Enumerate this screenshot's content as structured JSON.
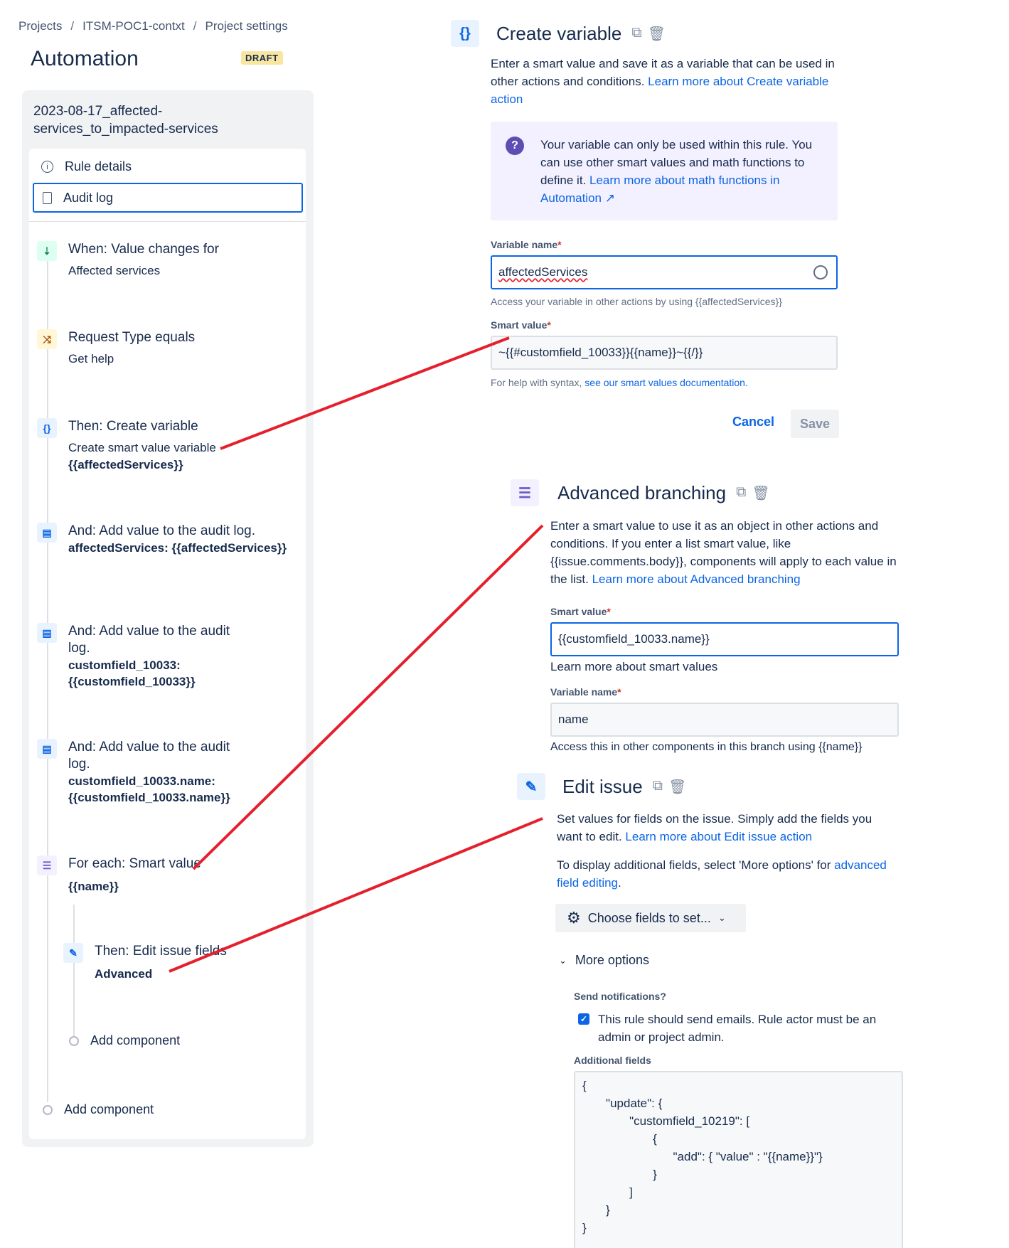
{
  "breadcrumb": {
    "projects": "Projects",
    "project": "ITSM-POC1-contxt",
    "settings": "Project settings",
    "sep": "/"
  },
  "page": {
    "title": "Automation",
    "status": "DRAFT"
  },
  "rule": {
    "name": "2023-08-17_affected-services_to_impacted-services"
  },
  "nav": {
    "rule_details": "Rule details",
    "audit_log": "Audit log"
  },
  "components": {
    "trigger": {
      "title": "When: Value changes for",
      "sub": "Affected services"
    },
    "condition": {
      "title": "Request Type equals",
      "sub": "Get help"
    },
    "create_var": {
      "title": "Then: Create variable",
      "sub": "Create smart value variable",
      "bold": "{{affectedServices}}"
    },
    "log1": {
      "title": "And: Add value to the audit log.",
      "bold": "affectedServices: {{affectedServices}}"
    },
    "log2": {
      "title": "And: Add value to the audit log.",
      "bold": "customfield_10033: {{customfield_10033}}"
    },
    "log3": {
      "title": "And: Add value to the audit log.",
      "bold": "customfield_10033.name: {{customfield_10033.name}}"
    },
    "foreach": {
      "title": "For each: Smart value",
      "bold": "{{name}}"
    },
    "edit": {
      "title": "Then: Edit issue fields",
      "bold": "Advanced"
    },
    "add_inner": "Add component",
    "add_outer": "Add component"
  },
  "create_variable_panel": {
    "title": "Create variable",
    "desc": "Enter a smart value and save it as a variable that can be used in other actions and conditions.",
    "desc_link": "Learn more about Create variable action",
    "info_text": "Your variable can only be used within this rule. You can use other smart values and math functions to define it.",
    "info_link": "Learn more about math functions in Automation ↗",
    "var_label": "Variable name",
    "var_value": "affectedServices",
    "var_help": "Access your variable in other actions by using {{affectedServices}}",
    "smart_label": "Smart value",
    "smart_value": "~{{#customfield_10033}}{{name}}~{{/}}",
    "syntax_help": "For help with syntax,",
    "syntax_link": "see our smart values documentation.",
    "cancel": "Cancel",
    "save": "Save"
  },
  "branch_panel": {
    "title": "Advanced branching",
    "desc": "Enter a smart value to use it as an object in other actions and conditions. If you enter a list smart value, like {{issue.comments.body}}, components will apply to each value in the list.",
    "desc_link": "Learn more about Advanced branching",
    "smart_label": "Smart value",
    "smart_value": "{{customfield_10033.name}}",
    "smart_link": "Learn more about smart values",
    "var_label": "Variable name",
    "var_value": "name",
    "var_help": "Access this in other components in this branch using {{name}}"
  },
  "edit_panel": {
    "title": "Edit issue",
    "desc": "Set values for fields on the issue. Simply add the fields you want to edit.",
    "desc_link": "Learn more about Edit issue action",
    "display": "To display additional fields, select 'More options' for",
    "display_link": "advanced field editing",
    "display_end": ".",
    "choose": "Choose fields to set...",
    "more": "More options",
    "notify_label": "Send notifications?",
    "notify_text": "This rule should send emails. Rule actor must be an admin or project admin.",
    "notify_checked": true,
    "additional_label": "Additional fields",
    "json": "{\n       \"update\": {\n              \"customfield_10219\": [\n                     {\n                           \"add\": { \"value\" : \"{{name}}\"}\n                     }\n              ]\n       }\n}"
  },
  "colors": {
    "accent": "#0c66e4",
    "annotation": "#e5202d",
    "draft": "#f8e6a0"
  }
}
